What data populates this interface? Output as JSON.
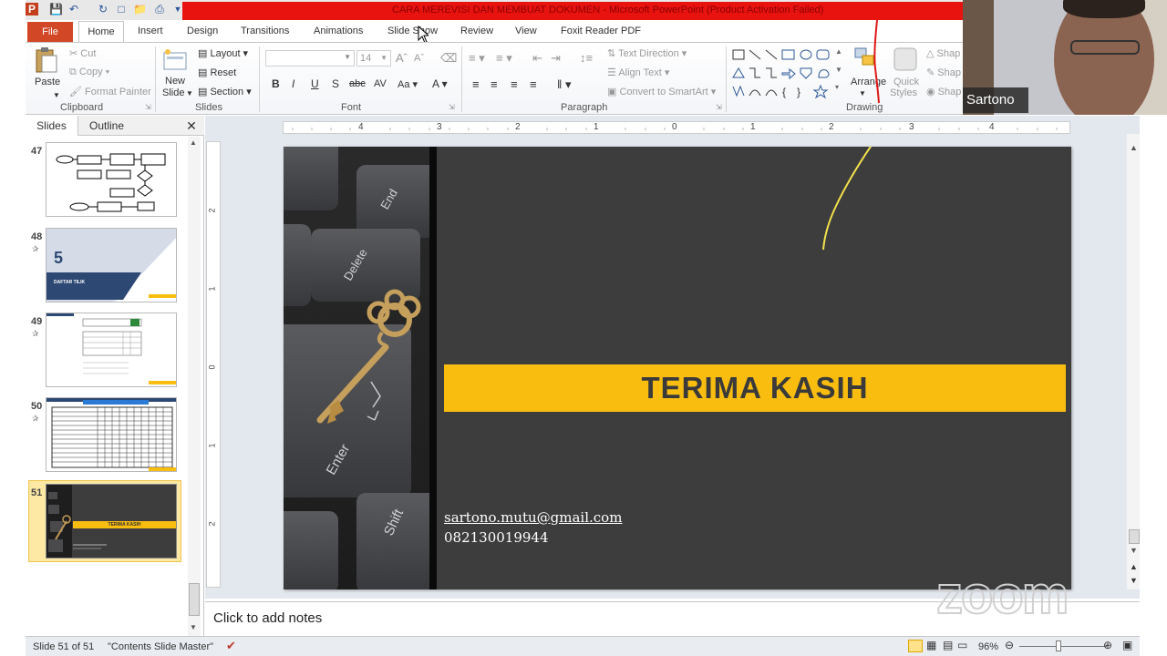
{
  "window": {
    "title": "CARA MEREVISI DAN MEMBUAT DOKUMEN  -  Microsoft PowerPoint (Product Activation Failed)"
  },
  "tabs": {
    "file": "File",
    "home": "Home",
    "insert": "Insert",
    "design": "Design",
    "transitions": "Transitions",
    "animations": "Animations",
    "slideshow": "Slide Show",
    "review": "Review",
    "view": "View",
    "foxit": "Foxit Reader PDF"
  },
  "ribbon": {
    "clipboard": {
      "label": "Clipboard",
      "paste": "Paste",
      "cut": "Cut",
      "copy": "Copy",
      "format_painter": "Format Painter"
    },
    "slides": {
      "label": "Slides",
      "new_slide_1": "New",
      "new_slide_2": "Slide",
      "layout": "Layout",
      "reset": "Reset",
      "section": "Section"
    },
    "font": {
      "label": "Font",
      "size": "14"
    },
    "paragraph": {
      "label": "Paragraph",
      "text_direction": "Text Direction",
      "align_text": "Align Text",
      "convert_smartart": "Convert to SmartArt"
    },
    "drawing": {
      "label": "Drawing",
      "arrange": "Arrange",
      "quick_1": "Quick",
      "quick_2": "Styles",
      "shape_fill": "Shap",
      "shape_outline": "Shap",
      "shape_effects": "Shap"
    }
  },
  "webcam": {
    "name": "Sartono"
  },
  "panel": {
    "tab_slides": "Slides",
    "tab_outline": "Outline",
    "thumbs": [
      {
        "num": "47"
      },
      {
        "num": "48",
        "big": "5",
        "small": "DAFTAR TILIK"
      },
      {
        "num": "49"
      },
      {
        "num": "50"
      },
      {
        "num": "51",
        "small": "TERIMA KASIH"
      }
    ]
  },
  "slide": {
    "keys": {
      "end": "End",
      "delete": "Delete",
      "enter": "Enter",
      "shift": "Shift"
    },
    "banner": "TERIMA KASIH",
    "email": "sartono.mutu@gmail.com",
    "phone": "082130019944"
  },
  "notes": {
    "placeholder": "Click to add notes"
  },
  "zoom_logo": "zoom",
  "status": {
    "slide_of": "Slide 51 of 51",
    "theme": "\"Contents Slide Master\"",
    "zoom": "96%"
  },
  "ruler": {
    "h_ticks": [
      "4",
      "3",
      "2",
      "1",
      "0",
      "1",
      "2",
      "3",
      "4"
    ],
    "v_ticks": [
      "2",
      "1",
      "0",
      "1",
      "2"
    ]
  },
  "colors": {
    "accent_banner": "#f9bd10",
    "slide_bg": "#3e3d3e",
    "file_tab": "#d24726",
    "title_red": "#e8130f"
  }
}
